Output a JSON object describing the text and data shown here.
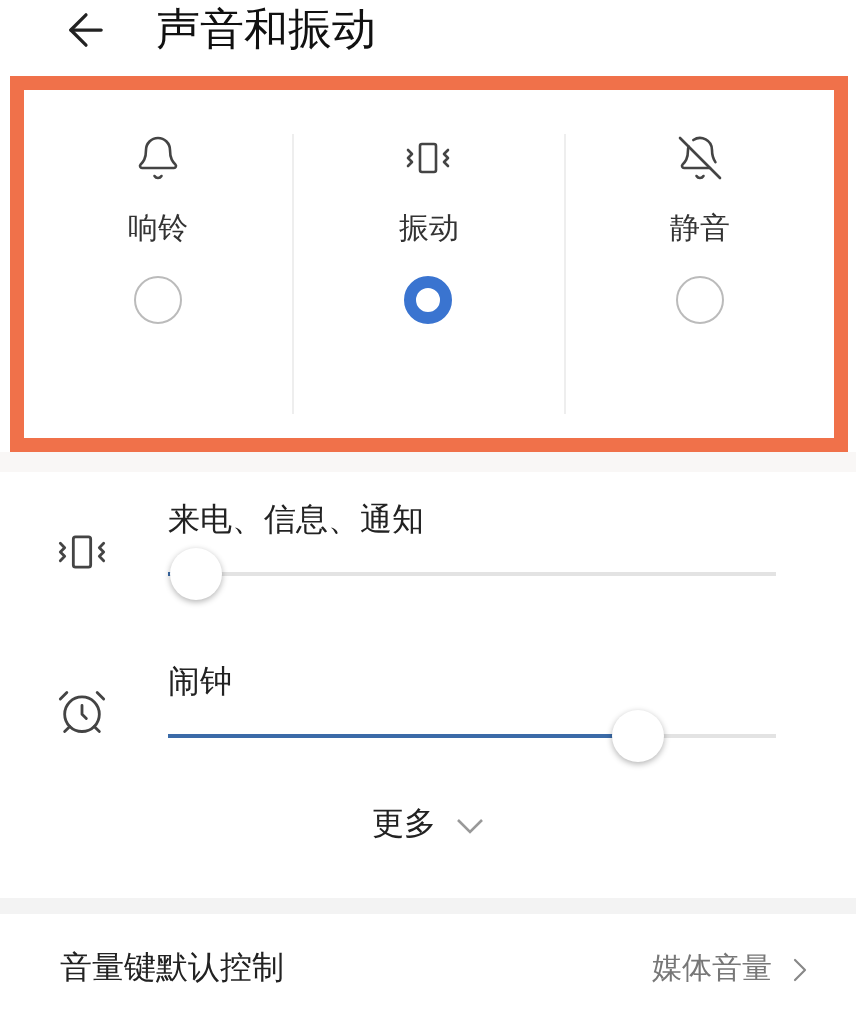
{
  "header": {
    "title": "声音和振动"
  },
  "modes": [
    {
      "kind": "ring",
      "label": "响铃",
      "selected": false
    },
    {
      "kind": "vibrate",
      "label": "振动",
      "selected": true
    },
    {
      "kind": "silent",
      "label": "静音",
      "selected": false
    }
  ],
  "volumes": [
    {
      "kind": "vibrate",
      "label": "来电、信息、通知",
      "level": 0
    },
    {
      "kind": "alarm",
      "label": "闹钟",
      "level": 0.8
    }
  ],
  "more": {
    "label": "更多"
  },
  "settings": [
    {
      "label": "音量键默认控制",
      "value": "媒体音量"
    }
  ]
}
